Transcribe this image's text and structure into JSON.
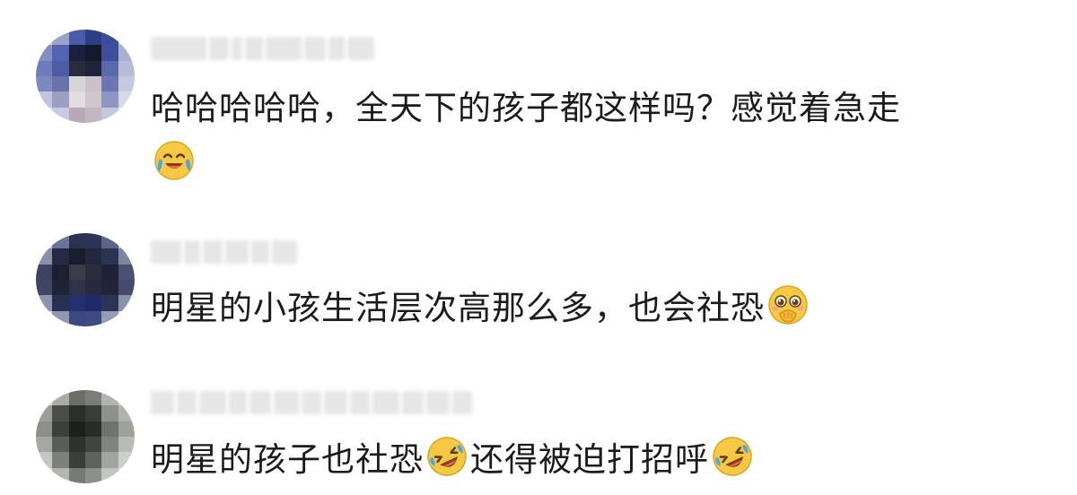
{
  "comments": [
    {
      "text": "哈哈哈哈哈，全天下的孩子都这样吗？感觉着急走",
      "emoji_after": "laugh-crying-icon"
    },
    {
      "text": "明星的小孩生活层次高那么多，也会社恐",
      "emoji_after": "shy-covering-mouth-icon"
    },
    {
      "text_part1": "明星的孩子也社恐",
      "emoji_mid": "rolling-on-floor-laughing-icon",
      "text_part2": "还得被迫打招呼",
      "emoji_after": "rolling-on-floor-laughing-icon"
    }
  ],
  "colors": {
    "text": "#1b1b1b",
    "background": "#ffffff",
    "blurred_name": "#e6e6e6",
    "emoji_yellow": "#f7c942"
  }
}
